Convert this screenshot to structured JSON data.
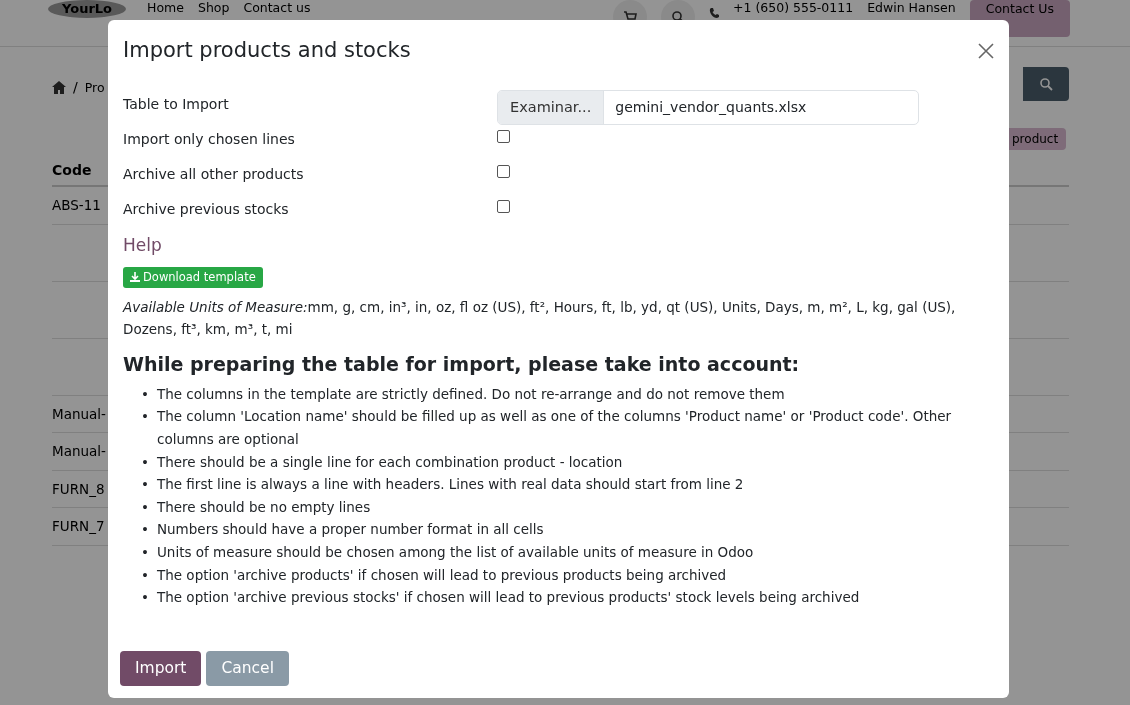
{
  "background": {
    "logo": "YourLo",
    "nav_links": [
      "Home",
      "Shop",
      "Contact us"
    ],
    "phone": "+1 (650) 555-0111",
    "user": "Edwin Hansen",
    "contact_button": "Contact Us",
    "breadcrumb_separator": "/",
    "breadcrumb": "Pro",
    "new_product_button": "product",
    "table": {
      "columns": [
        "Code"
      ],
      "rows": [
        "ABS-11",
        "",
        "",
        "",
        "Manual-",
        "Manual-",
        "FURN_8",
        "FURN_7"
      ]
    }
  },
  "modal": {
    "title": "Import products and stocks",
    "fields": [
      {
        "kind": "file",
        "label": "Table to Import",
        "button": "Examinar...",
        "value": "gemini_vendor_quants.xlsx"
      },
      {
        "kind": "checkbox",
        "label": "Import only chosen lines",
        "checked": false
      },
      {
        "kind": "checkbox",
        "label": "Archive all other products",
        "checked": false
      },
      {
        "kind": "checkbox",
        "label": "Archive previous stocks",
        "checked": false
      }
    ],
    "help_title": "Help",
    "download_button": "Download template",
    "units_label": "Available Units of Measure:",
    "units_text": "mm, g, cm, in³, in, oz, fl oz (US), ft², Hours, ft, lb, yd, qt (US), Units, Days, m, m², L, kg, gal (US), Dozens, ft³, km, m³, t, mi",
    "notes_title": "While preparing the table for import, please take into account:",
    "bullet": "•",
    "notes": [
      "The columns in the template are strictly defined. Do not re-arrange and do not remove them",
      "The column 'Location name' should be filled up as well as one of the columns 'Product name' or 'Product code'. Other columns are optional",
      "There should be a single line for each combination product - location",
      "The first line is always a line with headers. Lines with real data should start from line 2",
      "There should be no empty lines",
      "Numbers should have a proper number format in all cells",
      "Units of measure should be chosen among the list of available units of measure in Odoo",
      "The option 'archive products' if chosen will lead to previous products being archived",
      "The option 'archive previous stocks' if chosen will lead to previous products' stock levels being archived"
    ],
    "buttons": [
      {
        "kind": "primary",
        "label": "Import"
      },
      {
        "kind": "secondary",
        "label": "Cancel"
      }
    ]
  }
}
